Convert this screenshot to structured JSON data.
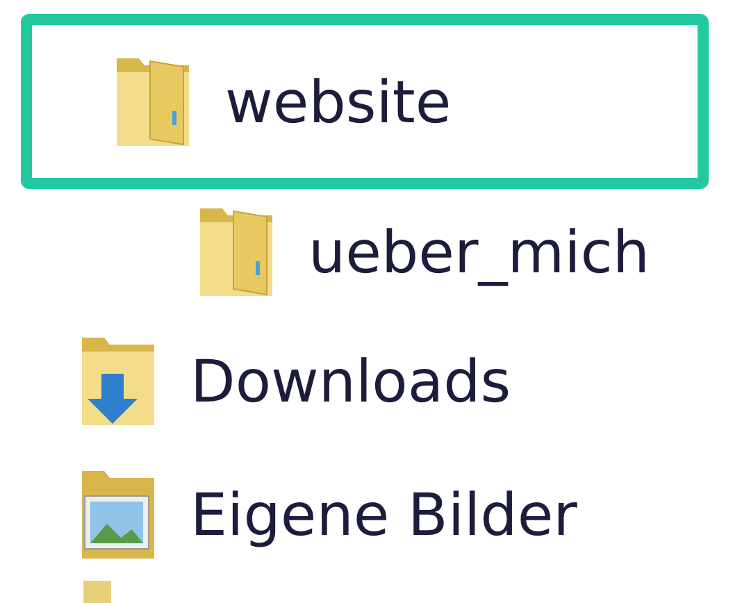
{
  "tree": [
    {
      "label": "website",
      "kind": "folder",
      "highlighted": true,
      "children": [
        {
          "label": "ueber_mich",
          "kind": "folder",
          "highlighted": false
        }
      ]
    },
    {
      "label": "Downloads",
      "kind": "downloads",
      "highlighted": false
    },
    {
      "label": "Eigene Bilder",
      "kind": "pictures",
      "highlighted": false
    }
  ]
}
